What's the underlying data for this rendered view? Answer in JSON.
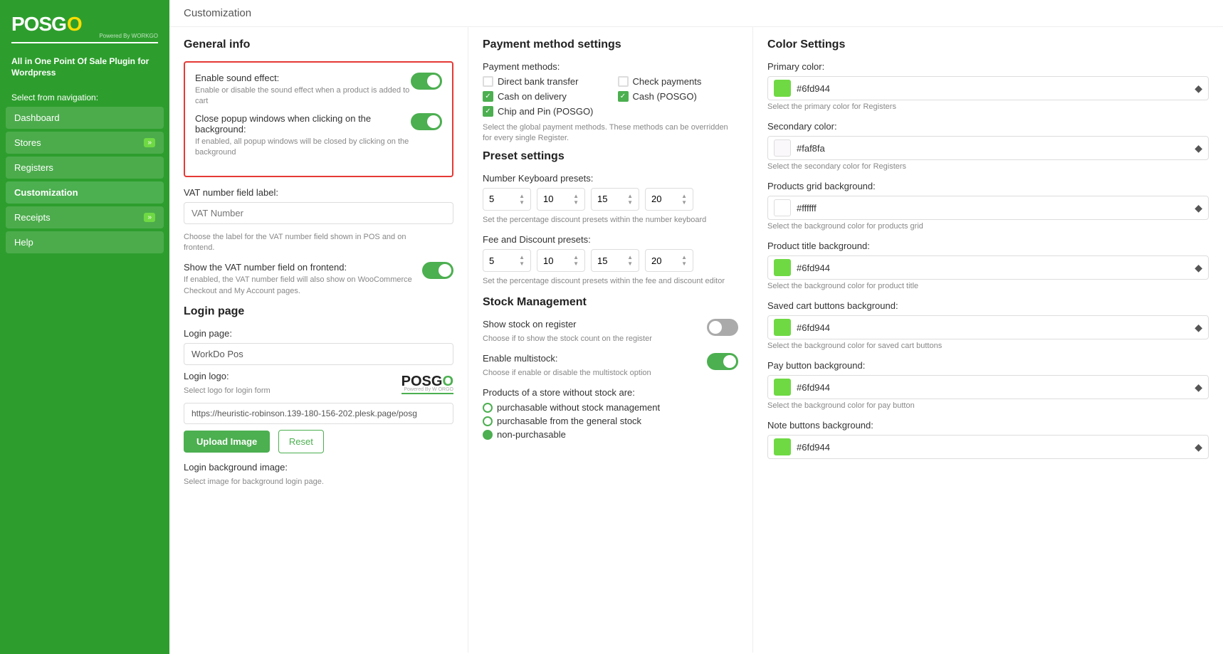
{
  "sidebar": {
    "logo": {
      "pos": "POS",
      "go": "G",
      "o": "O",
      "powered": "Powered By WORKGO"
    },
    "tagline": "All in One Point Of Sale Plugin for Wordpress",
    "nav_label": "Select from navigation:",
    "items": [
      {
        "id": "dashboard",
        "label": "Dashboard",
        "badge": null,
        "active": false
      },
      {
        "id": "stores",
        "label": "Stores",
        "badge": "»",
        "active": false
      },
      {
        "id": "registers",
        "label": "Registers",
        "badge": null,
        "active": false
      },
      {
        "id": "customization",
        "label": "Customization",
        "badge": null,
        "active": true
      },
      {
        "id": "receipts",
        "label": "Receipts",
        "badge": "»",
        "active": false
      },
      {
        "id": "help",
        "label": "Help",
        "badge": null,
        "active": false
      }
    ]
  },
  "page": {
    "title": "Customization"
  },
  "general_info": {
    "title": "General info",
    "sound_effect": {
      "label": "Enable sound effect:",
      "desc": "Enable or disable the sound effect when a product is added to cart",
      "enabled": true
    },
    "close_popup": {
      "label": "Close popup windows when clicking on the background:",
      "desc": "If enabled, all popup windows will be closed by clicking on the background",
      "enabled": true
    },
    "vat_label": {
      "label": "VAT number field label:",
      "placeholder": "VAT Number",
      "desc1": "Choose the label for the VAT number field shown in POS and on",
      "desc2": "frontend."
    },
    "show_vat": {
      "label": "Show the VAT number field on frontend:",
      "desc": "If enabled, the VAT number field will also show on WooCommerce Checkout and My Account pages.",
      "enabled": true
    }
  },
  "login_page": {
    "title": "Login page",
    "login_page_label": "Login page:",
    "login_page_value": "WorkDo Pos",
    "login_logo_label": "Login logo:",
    "login_logo_desc": "Select logo for login form",
    "logo_display": {
      "pos": "POS",
      "go": "G",
      "o": "O",
      "powered": "Powered By W ORGO"
    },
    "url_value": "https://heuristic-robinson.139-180-156-202.plesk.page/posg",
    "upload_label": "Upload Image",
    "reset_label": "Reset",
    "background_label": "Login background image:",
    "background_desc": "Select image for background login page."
  },
  "payment": {
    "title": "Payment method settings",
    "methods_label": "Payment methods:",
    "methods": [
      {
        "label": "Direct bank transfer",
        "checked": false
      },
      {
        "label": "Check payments",
        "checked": false
      },
      {
        "label": "Cash on delivery",
        "checked": true
      },
      {
        "label": "Cash (POSGO)",
        "checked": true
      },
      {
        "label": "Chip and Pin (POSGO)",
        "checked": true
      }
    ],
    "methods_desc": "Select the global payment methods. These methods can be overridden for every single Register."
  },
  "preset": {
    "title": "Preset settings",
    "keyboard_label": "Number Keyboard presets:",
    "keyboard_values": [
      5,
      10,
      15,
      20
    ],
    "keyboard_desc": "Set the percentage discount presets within the number keyboard",
    "fee_label": "Fee and Discount presets:",
    "fee_values": [
      5,
      10,
      15,
      20
    ],
    "fee_desc": "Set the percentage discount presets within the fee and discount editor"
  },
  "stock": {
    "title": "Stock Management",
    "show_stock_label": "Show stock on register",
    "show_stock_desc": "Choose if to show the stock count on the register",
    "show_stock_enabled": false,
    "multistock_label": "Enable multistock:",
    "multistock_desc": "Choose if enable or disable the multistock option",
    "multistock_enabled": true,
    "without_stock_label": "Products of a store without stock are:",
    "options": [
      {
        "label": "purchasable without stock management",
        "checked": false
      },
      {
        "label": "purchasable from the general stock",
        "checked": false
      },
      {
        "label": "non-purchasable",
        "checked": true
      }
    ]
  },
  "colors": {
    "title": "Color Settings",
    "items": [
      {
        "id": "primary",
        "label": "Primary color:",
        "value": "#6fd944",
        "swatch": "#6fd944",
        "desc": "Select the primary color for Registers"
      },
      {
        "id": "secondary",
        "label": "Secondary color:",
        "value": "#faf8fa",
        "swatch": "#faf8fa",
        "desc": "Select the secondary color for Registers"
      },
      {
        "id": "products_grid",
        "label": "Products grid background:",
        "value": "#ffffff",
        "swatch": "#ffffff",
        "desc": "Select the background color for products grid"
      },
      {
        "id": "product_title",
        "label": "Product title background:",
        "value": "#6fd944",
        "swatch": "#6fd944",
        "desc": "Select the background color for product title"
      },
      {
        "id": "saved_cart",
        "label": "Saved cart buttons background:",
        "value": "#6fd944",
        "swatch": "#6fd944",
        "desc": "Select the background color for saved cart buttons"
      },
      {
        "id": "pay_button",
        "label": "Pay button background:",
        "value": "#6fd944",
        "swatch": "#6fd944",
        "desc": "Select the background color for pay button"
      },
      {
        "id": "note_buttons",
        "label": "Note buttons background:",
        "value": "#6fd944",
        "swatch": "#6fd944",
        "desc": ""
      }
    ]
  }
}
